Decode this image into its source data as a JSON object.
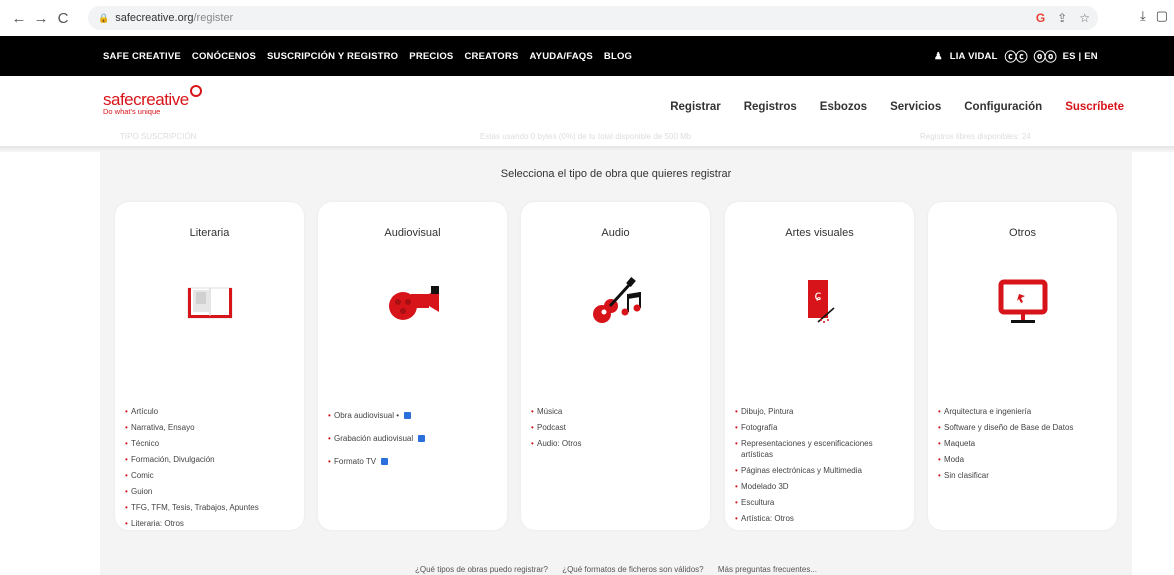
{
  "browser": {
    "url_host": "safecreative.org",
    "url_path": "/register"
  },
  "topnav": {
    "links": [
      "SAFE CREATIVE",
      "CONÓCENOS",
      "SUSCRIPCIÓN Y REGISTRO",
      "PRECIOS",
      "CREATORS",
      "AYUDA/FAQS",
      "BLOG"
    ],
    "user_name": "LIA VIDAL",
    "cc_badge_1": "ⓒⓒ",
    "cc_badge_2": "ⓞⓞ",
    "language": "ES | EN"
  },
  "header": {
    "logo_safe": "safe",
    "logo_creative": "creative",
    "logo_tagline": "Do what's unique",
    "menu": [
      "Registrar",
      "Registros",
      "Esbozos",
      "Servicios",
      "Configuración"
    ],
    "cta": "Suscríbete",
    "ghost_left": "TIPO SUSCRIPCIÓN",
    "ghost_middle": "Estás usando 0 bytes (0%) de tu total disponible de 500 Mb",
    "ghost_right": "Registros libres disponibles: 24"
  },
  "main": {
    "prompt": "Selecciona el tipo de obra que quieres registrar",
    "categories": [
      {
        "title": "Literaria",
        "icon": "book-icon",
        "items": [
          "Artículo",
          "Narrativa, Ensayo",
          "Técnico",
          "Formación, Divulgación",
          "Comic",
          "Guion",
          "TFG, TFM, Tesis, Trabajos, Apuntes",
          "Literaria: Otros"
        ]
      },
      {
        "title": "Audiovisual",
        "icon": "film-camera-icon",
        "items": [
          "Obra audiovisual  •",
          "Grabación audiovisual",
          "Formato TV"
        ]
      },
      {
        "title": "Audio",
        "icon": "guitar-icon",
        "items": [
          "Música",
          "Podcast",
          "Audio: Otros"
        ]
      },
      {
        "title": "Artes visuales",
        "icon": "painting-icon",
        "items": [
          "Dibujo, Pintura",
          "Fotografía",
          "Representaciones y escenificaciones artísticas",
          "Páginas electrónicas y Multimedia",
          "Modelado 3D",
          "Escultura",
          "Artística: Otros"
        ]
      },
      {
        "title": "Otros",
        "icon": "monitor-icon",
        "items": [
          "Arquitectura e ingeniería",
          "Software y diseño de Base de Datos",
          "Maqueta",
          "Moda",
          "Sin clasificar"
        ]
      }
    ]
  },
  "faq_links": [
    "¿Qué tipos de obras puedo registrar?",
    "¿Qué formatos de ficheros son válidos?",
    "Más preguntas frecuentes..."
  ],
  "colors": {
    "brand_red": "#d7141a",
    "nav_black": "#000000",
    "info_blue": "#2a6fdb"
  }
}
